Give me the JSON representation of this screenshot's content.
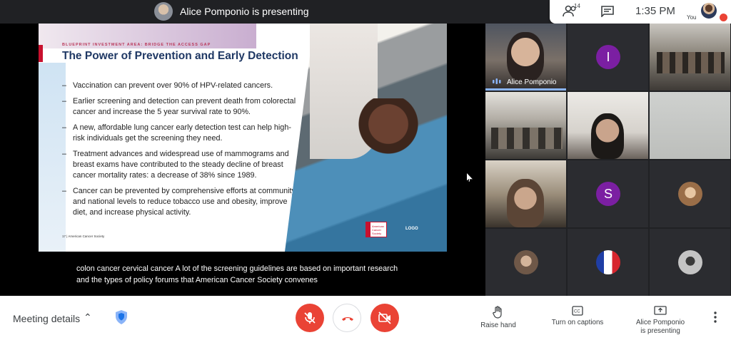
{
  "topbar": {
    "presenter_label": "Alice Pomponio is presenting",
    "participants_count": "14",
    "time": "1:35 PM",
    "self_label": "You"
  },
  "slide": {
    "kicker": "BLUEPRINT INVESTMENT AREA: BRIDGE THE ACCESS GAP",
    "title": "The Power of Prevention and Early Detection",
    "bullets": [
      "Vaccination can prevent over 90% of HPV-related cancers.",
      "Earlier screening and detection can prevent death from colorectal cancer and increase the 5 year survival rate to 90%.",
      "A new, affordable lung cancer early detection test can help high-risk individuals get the screening they need.",
      "Treatment advances and widespread use of mammograms and breast exams have contributed to the steady decline of breast cancer mortality rates: a decrease of 38% since 1989.",
      "Cancer can be prevented by comprehensive efforts at community and national levels to reduce tobacco use and obesity, improve diet, and increase physical activity."
    ],
    "footer": "17 | American Cancer Society",
    "logo_text": "American Cancer Society",
    "logo_placeholder": "LOGO"
  },
  "captions": {
    "line1": "colon cancer cervical cancer A lot of the screening guidelines are based on important research",
    "line2": "and the types of policy forums that American Cancer Society convenes"
  },
  "tiles": {
    "alice_name": "Alice Pomponio",
    "letter_i": "I",
    "letter_s": "S"
  },
  "bottombar": {
    "meeting_details": "Meeting details",
    "raise_hand": "Raise hand",
    "captions": "Turn on captions",
    "presenting_line1": "Alice Pomponio",
    "presenting_line2": "is presenting"
  },
  "colors": {
    "danger": "#ea4335",
    "speaking": "#8ab4f8",
    "avatar_purple": "#7b1fa2",
    "slide_title": "#1f3864"
  },
  "icons": [
    "people-icon",
    "chat-icon",
    "mic-off-icon",
    "hangup-icon",
    "camera-off-icon",
    "hand-icon",
    "captions-icon",
    "present-icon",
    "more-vert-icon",
    "shield-icon",
    "chevron-up-icon",
    "speaking-icon"
  ]
}
